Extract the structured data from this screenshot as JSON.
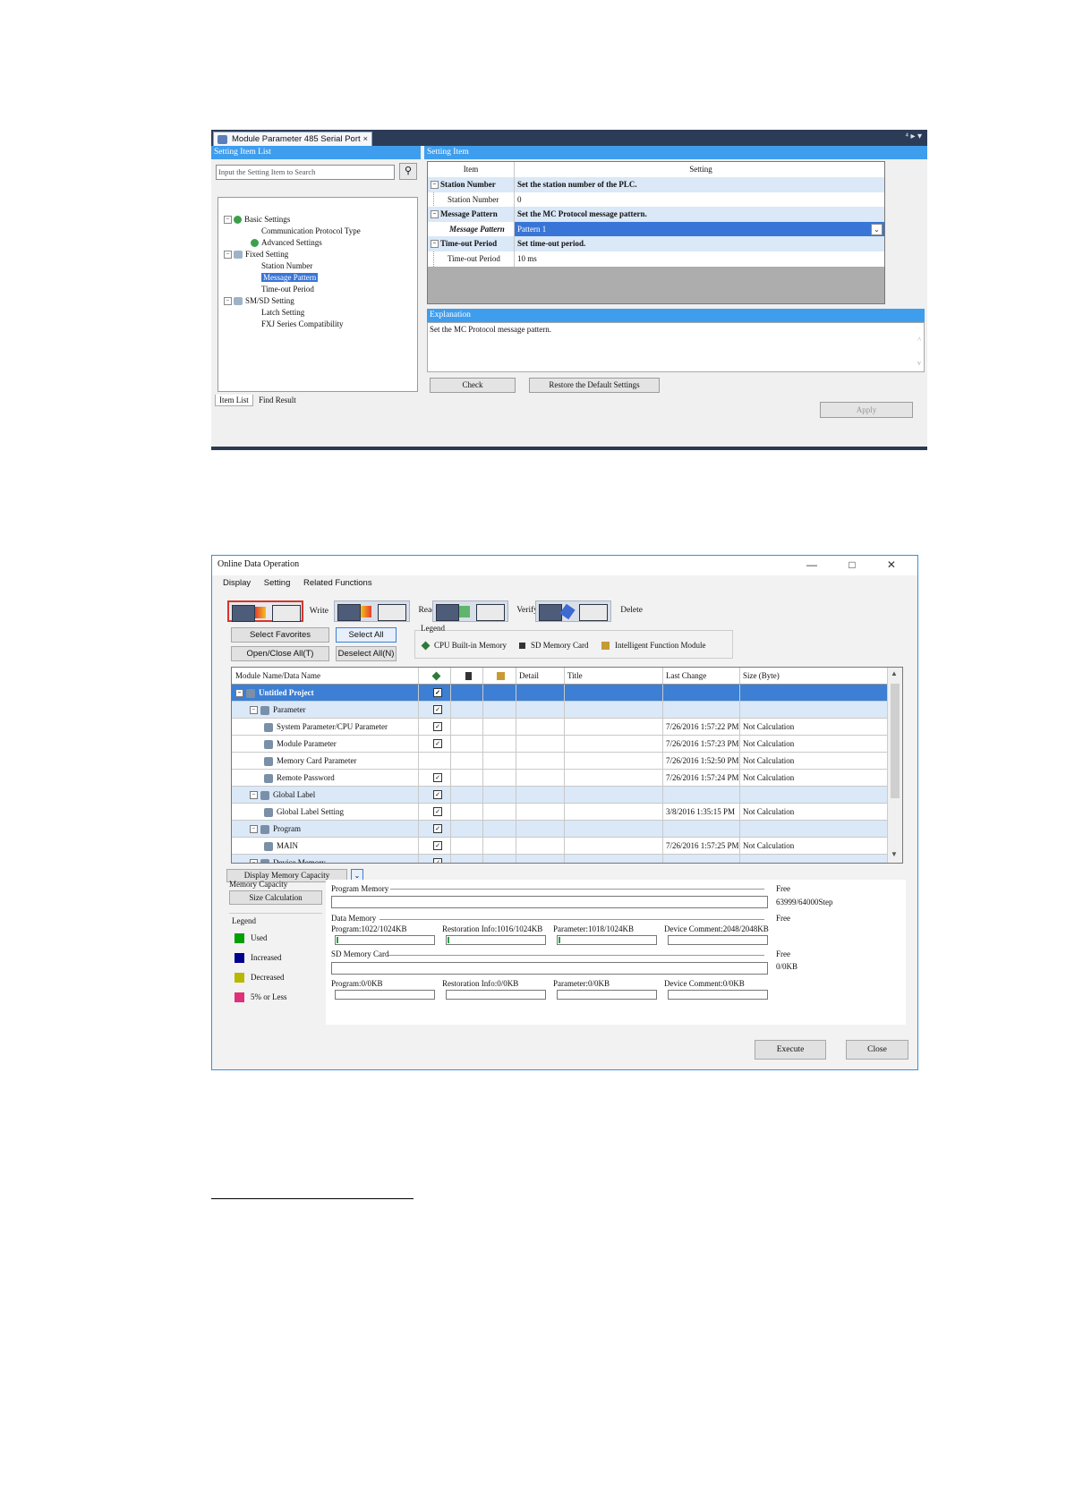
{
  "screenshot1": {
    "tab_title": "Module Parameter 485 Serial Port",
    "tab_close": "×",
    "tab_controls": "⁴ ▸ ▾",
    "left_header": "Setting Item List",
    "search_placeholder": "Input the Setting Item to Search",
    "tree": [
      {
        "label": "Basic Settings",
        "level": 0,
        "exp": "−",
        "icon": "check"
      },
      {
        "label": "Communication Protocol Type",
        "level": 1
      },
      {
        "label": "Advanced Settings",
        "level": 1,
        "icon": "check"
      },
      {
        "label": "Fixed Setting",
        "level": 0,
        "exp": "−",
        "icon": "gear"
      },
      {
        "label": "Station Number",
        "level": 1
      },
      {
        "label": "Message Pattern",
        "level": 1,
        "selected": true
      },
      {
        "label": "Time-out Period",
        "level": 1
      },
      {
        "label": "SM/SD Setting",
        "level": 0,
        "exp": "−",
        "icon": "gear"
      },
      {
        "label": "Latch Setting",
        "level": 1
      },
      {
        "label": "FXJ Series Compatibility",
        "level": 1
      }
    ],
    "bottom_tabs": [
      "Item List",
      "Find Result"
    ],
    "right_header": "Setting Item",
    "grid_head": {
      "item": "Item",
      "setting": "Setting"
    },
    "grid_rows": [
      {
        "kind": "cat",
        "item": "Station Number",
        "setting": "Set the station number of the PLC."
      },
      {
        "kind": "val",
        "item": "Station Number",
        "setting": "0"
      },
      {
        "kind": "cat",
        "item": "Message Pattern",
        "setting": "Set the MC Protocol message pattern."
      },
      {
        "kind": "sel",
        "item": "Message Pattern",
        "setting": "Pattern 1"
      },
      {
        "kind": "cat",
        "item": "Time-out Period",
        "setting": "Set time-out period."
      },
      {
        "kind": "val",
        "item": "Time-out Period",
        "setting": "10 ms"
      }
    ],
    "explanation_header": "Explanation",
    "explanation_text": "Set the MC Protocol message pattern.",
    "buttons": {
      "check": "Check",
      "restore": "Restore the Default Settings",
      "apply": "Apply"
    }
  },
  "screenshot2": {
    "window_title": "Online Data Operation",
    "window_controls": "— □ ✕",
    "menu": [
      "Display",
      "Setting",
      "Related Functions"
    ],
    "operations": [
      "Write",
      "Read",
      "Verify",
      "Delete"
    ],
    "buttons": {
      "select_favorites": "Select Favorites",
      "select_all": "Select All",
      "open_close_all": "Open/Close All(T)",
      "deselect_all": "Deselect All(N)",
      "display_memory_capacity": "Display Memory Capacity",
      "size_calculation": "Size Calculation",
      "execute": "Execute",
      "close": "Close"
    },
    "legend_title": "Legend",
    "legend_items": [
      "CPU Built-in Memory",
      "SD Memory Card",
      "Intelligent Function Module"
    ],
    "table_headers": {
      "name": "Module Name/Data Name",
      "detail": "Detail",
      "title": "Title",
      "last_change": "Last Change",
      "size": "Size (Byte)"
    },
    "rows": [
      {
        "kind": "root",
        "name": "Untitled Project",
        "indent": 0,
        "exp": "−",
        "check": true,
        "last_change": "",
        "size": ""
      },
      {
        "kind": "grp",
        "name": "Parameter",
        "indent": 1,
        "exp": "−",
        "check": true,
        "last_change": "",
        "size": ""
      },
      {
        "kind": "item",
        "name": "System Parameter/CPU Parameter",
        "indent": 2,
        "check": true,
        "last_change": "7/26/2016 1:57:22 PM",
        "size": "Not Calculation"
      },
      {
        "kind": "item",
        "name": "Module Parameter",
        "indent": 2,
        "check": true,
        "last_change": "7/26/2016 1:57:23 PM",
        "size": "Not Calculation"
      },
      {
        "kind": "item",
        "name": "Memory Card Parameter",
        "indent": 2,
        "check": false,
        "last_change": "7/26/2016 1:52:50 PM",
        "size": "Not Calculation"
      },
      {
        "kind": "item",
        "name": "Remote Password",
        "indent": 2,
        "check": true,
        "last_change": "7/26/2016 1:57:24 PM",
        "size": "Not Calculation"
      },
      {
        "kind": "grp",
        "name": "Global Label",
        "indent": 1,
        "exp": "−",
        "check": true,
        "last_change": "",
        "size": ""
      },
      {
        "kind": "item",
        "name": "Global Label Setting",
        "indent": 2,
        "check": true,
        "last_change": "3/8/2016 1:35:15 PM",
        "size": "Not Calculation"
      },
      {
        "kind": "grp",
        "name": "Program",
        "indent": 1,
        "exp": "−",
        "check": true,
        "last_change": "",
        "size": ""
      },
      {
        "kind": "item",
        "name": "MAIN",
        "indent": 2,
        "check": true,
        "last_change": "7/26/2016 1:57:25 PM",
        "size": "Not Calculation"
      },
      {
        "kind": "grp",
        "name": "Device Memory",
        "indent": 1,
        "exp": "−",
        "check": true,
        "last_change": "",
        "size": ""
      }
    ],
    "memory": {
      "capacity_label": "Memory Capacity",
      "legend_title": "Legend",
      "legend": [
        {
          "label": "Used",
          "color": "#00a000"
        },
        {
          "label": "Increased",
          "color": "#000090"
        },
        {
          "label": "Decreased",
          "color": "#b8b800"
        },
        {
          "label": "5% or Less",
          "color": "#e0307a"
        }
      ],
      "program_memory": "Program Memory",
      "free": "Free",
      "program_free": "63999/64000Step",
      "data_memory": "Data Memory",
      "dm_program": "Program:1022/1024KB",
      "dm_restoration": "Restoration Info:1016/1024KB",
      "dm_parameter": "Parameter:1018/1024KB",
      "dm_device_comment": "Device Comment:2048/2048KB",
      "sd_memory_card": "SD Memory Card",
      "sd_free": "0/0KB",
      "sd_program": "Program:0/0KB",
      "sd_restoration": "Restoration Info:0/0KB",
      "sd_parameter": "Parameter:0/0KB",
      "sd_device_comment": "Device Comment:0/0KB"
    }
  }
}
